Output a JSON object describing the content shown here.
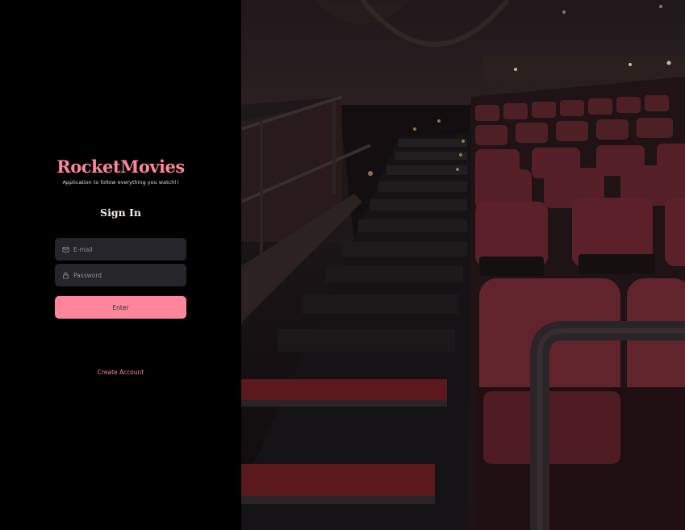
{
  "brand": {
    "title": "RocketMovies",
    "subtitle": "Application to follow everything you watch!!"
  },
  "form": {
    "title": "Sign In",
    "email_placeholder": "E-mail",
    "password_placeholder": "Password",
    "submit_label": "Enter",
    "create_account_label": "Create Account",
    "email_icon": "mail-icon",
    "password_icon": "lock-icon"
  },
  "background": {
    "image_name": "movie-theater-background"
  },
  "colors": {
    "accent": "#FF859B",
    "input_bg": "#262529",
    "page_bg": "#000000"
  }
}
